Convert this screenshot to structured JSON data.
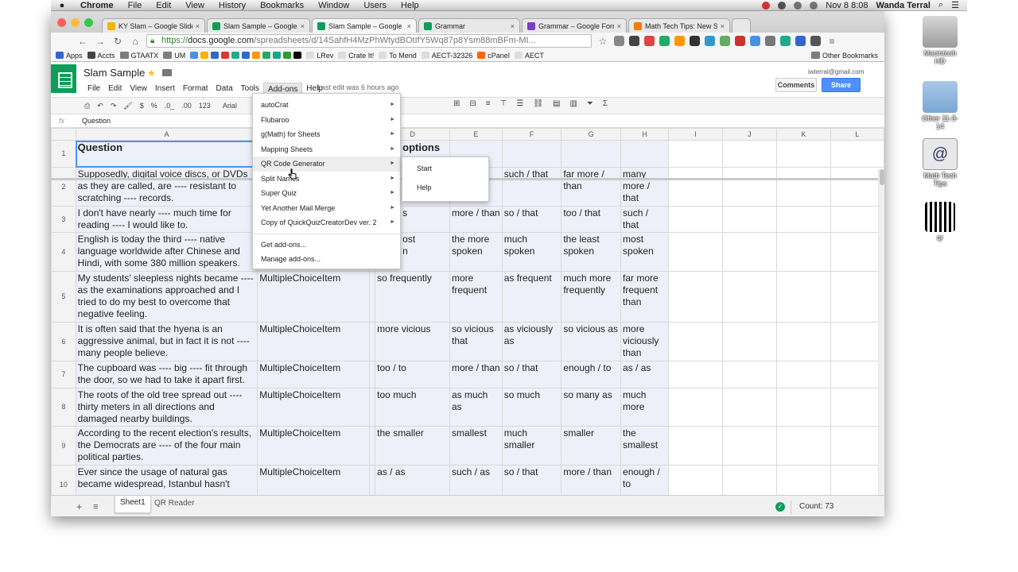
{
  "menubar": {
    "app": "Chrome",
    "items": [
      "File",
      "Edit",
      "View",
      "History",
      "Bookmarks",
      "Window",
      "Users",
      "Help"
    ],
    "clock": "Nov 8  8:08",
    "user": "Wanda Terral"
  },
  "browser": {
    "tabs": [
      {
        "label": "KY Slam – Google Slides",
        "color": "#f4b400"
      },
      {
        "label": "Slam Sample – Google Sh",
        "color": "#0f9d58"
      },
      {
        "label": "Slam Sample – Google She",
        "color": "#0f9d58"
      },
      {
        "label": "Grammar",
        "color": "#0f9d58"
      },
      {
        "label": "Grammar – Google Forms",
        "color": "#7b3fc4"
      },
      {
        "label": "Math Tech Tips: New Scrip",
        "color": "#f57c00"
      }
    ],
    "url_scheme": "https://",
    "url_host": "docs.google.com",
    "url_rest": "/spreadsheets/d/14SahfH4MzPhWtydBOtIfY5Wq87p8Ysm88mBFm-MI...",
    "bookmarks": [
      "Apps",
      "Accts",
      "GTAATX",
      "UM",
      "LRev",
      "Crate It!",
      "To Mend",
      "AECT-32326",
      "cPanel",
      "AECT"
    ],
    "other_bookmarks": "Other Bookmarks"
  },
  "doc": {
    "title": "Slam Sample",
    "menus": [
      "File",
      "Edit",
      "View",
      "Insert",
      "Format",
      "Data",
      "Tools",
      "Add-ons",
      "Help"
    ],
    "last_edit": "Last edit was 6 hours ago",
    "email": "iwterral@gmail.com",
    "comments": "Comments",
    "share": "Share"
  },
  "format_toolbar": {
    "percent": "%",
    "currency": "$",
    "dec1": ".0_",
    "dec2": ".00",
    "numfmt": "123",
    "font": "Arial"
  },
  "formula": {
    "fx": "fx",
    "value": "Question"
  },
  "columns": [
    "",
    "A",
    "B",
    "C",
    "D",
    "E",
    "F",
    "G",
    "H",
    "I",
    "J",
    "K",
    "L"
  ],
  "rows": [
    {
      "n": "1",
      "cells": [
        "Question",
        "",
        "",
        "options",
        "",
        "",
        "",
        ""
      ]
    },
    {
      "n": "2",
      "cells": [
        "Supposedly, digital voice discs, or DVDs as they are called, are ---- resistant to scratching ---- records.",
        "",
        "",
        "",
        "",
        "such / that",
        "far more / than",
        "many more / that"
      ]
    },
    {
      "n": "3",
      "cells": [
        "I don't have nearly ---- much time for reading ---- I would like to.",
        "",
        "",
        "s",
        "more / than",
        "so / that",
        "too / that",
        "such / that"
      ]
    },
    {
      "n": "4",
      "cells": [
        "English is today the third ---- native language worldwide after Chinese and Hindi, with some 380 million speakers.",
        "",
        "",
        "ost\nn",
        "the more spoken",
        "much spoken",
        "the least spoken",
        "most spoken"
      ]
    },
    {
      "n": "5",
      "cells": [
        "My students' sleepless nights became ---- as the examinations approached and I tried to do my best to overcome that negative feeling.",
        "MultipleChoiceItem",
        "",
        "so frequently",
        "more frequent",
        "as frequent",
        "much more frequently",
        "far more frequent than"
      ]
    },
    {
      "n": "6",
      "cells": [
        "It is often said that the hyena is an aggressive animal, but in fact it is not ---- many people believe.",
        "MultipleChoiceItem",
        "",
        "more vicious",
        "so vicious that",
        "as viciously as",
        "so vicious as",
        "more viciously than"
      ]
    },
    {
      "n": "7",
      "cells": [
        "The cupboard was ---- big ---- fit through the door, so we had to take it apart first.",
        "MultipleChoiceItem",
        "",
        "too / to",
        "more / than",
        "so / that",
        "enough / to",
        "as / as"
      ]
    },
    {
      "n": "8",
      "cells": [
        "The roots of the old tree spread out ---- thirty meters in all directions and damaged nearby buildings.",
        "MultipleChoiceItem",
        "",
        "too much",
        "as much as",
        "so much",
        "so many as",
        "much more"
      ]
    },
    {
      "n": "9",
      "cells": [
        "According to the recent election's results, the Democrats are ---- of the four main political parties.",
        "MultipleChoiceItem",
        "",
        "the smaller",
        "smallest",
        "much smaller",
        "smaller",
        "the smallest"
      ]
    },
    {
      "n": "10",
      "cells": [
        "Ever since the usage of natural gas became widespread, Istanbul hasn't",
        "MultipleChoiceItem",
        "",
        "as / as",
        "such / as",
        "so / that",
        "more / than",
        "enough / to"
      ]
    }
  ],
  "addons_menu": {
    "items": [
      "autoCrat",
      "Flubaroo",
      "g(Math) for Sheets",
      "Mapping Sheets",
      "QR Code Generator",
      "Split Names",
      "Super Quiz",
      "Yet Another Mail Merge",
      "Copy of QuickQuizCreatorDev ver. 2"
    ],
    "footer": [
      "Get add-ons...",
      "Manage add-ons..."
    ],
    "highlighted": "QR Code Generator"
  },
  "submenu": {
    "items": [
      "Start",
      "Help"
    ]
  },
  "sheet_tabs": [
    "Sheet1",
    "QR Reader"
  ],
  "status": {
    "count": "Count: 73"
  },
  "desktop": {
    "icons": [
      "Macintosh HD",
      "Other 11-3-14",
      "Math Tech Tips",
      "qr"
    ]
  },
  "colors": {
    "sheets_green": "#0f9d58",
    "share_blue": "#4d90fe",
    "selection_blue": "#4d90fe",
    "row_shade": "#eef0f9"
  }
}
